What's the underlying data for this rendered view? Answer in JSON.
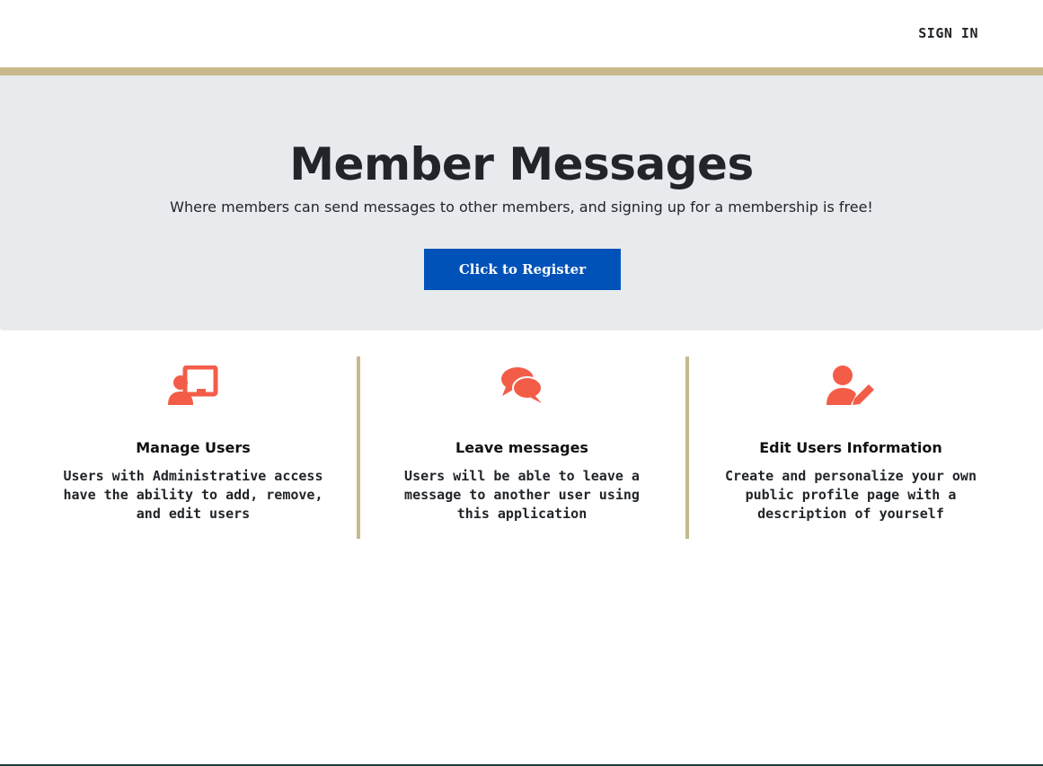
{
  "nav": {
    "signin_label": "SIGN IN"
  },
  "hero": {
    "title": "Member Messages",
    "subtitle": "Where members can send messages to other members, and signing up for a membership is free!",
    "register_label": "Click to Register"
  },
  "features": [
    {
      "icon": "user-presentation-icon",
      "title": "Manage Users",
      "description": "Users with Administrative access have the ability to add, remove, and edit users"
    },
    {
      "icon": "chat-bubbles-icon",
      "title": "Leave messages",
      "description": "Users will be able to leave a message to another user using this application"
    },
    {
      "icon": "user-edit-icon",
      "title": "Edit Users Information",
      "description": "Create and personalize your own public profile page with a description of yourself"
    }
  ],
  "colors": {
    "accent": "#c8b98a",
    "hero_bg": "#e8ebee",
    "button": "#0052b8",
    "icon": "#f35d48"
  }
}
